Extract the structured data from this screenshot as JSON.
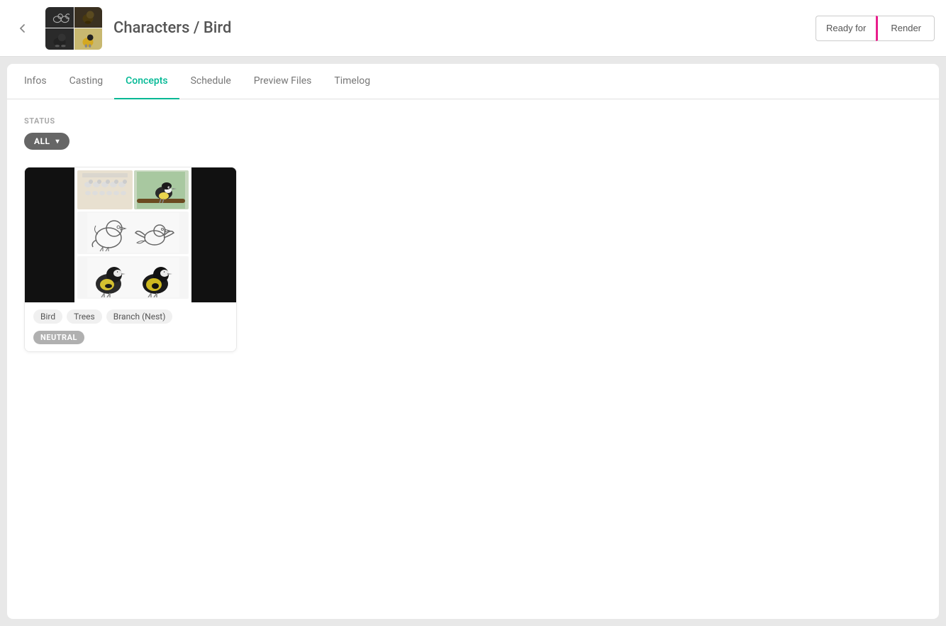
{
  "topbar": {
    "title": "Characters / Bird",
    "ready_for_label": "Ready for",
    "render_label": "Render"
  },
  "tabs": [
    {
      "id": "infos",
      "label": "Infos",
      "active": false
    },
    {
      "id": "casting",
      "label": "Casting",
      "active": false
    },
    {
      "id": "concepts",
      "label": "Concepts",
      "active": true
    },
    {
      "id": "schedule",
      "label": "Schedule",
      "active": false
    },
    {
      "id": "preview-files",
      "label": "Preview Files",
      "active": false
    },
    {
      "id": "timelog",
      "label": "Timelog",
      "active": false
    }
  ],
  "status_section": {
    "label": "STATUS",
    "dropdown_value": "ALL",
    "chevron": "▾"
  },
  "concept_card": {
    "tags": [
      "Bird",
      "Trees",
      "Branch (Nest)"
    ],
    "status_badge": "NEUTRAL"
  },
  "colors": {
    "active_tab": "#00b894",
    "accent_pink": "#e91e8c",
    "status_badge_bg": "#b0b0b0",
    "dropdown_bg": "#666"
  }
}
